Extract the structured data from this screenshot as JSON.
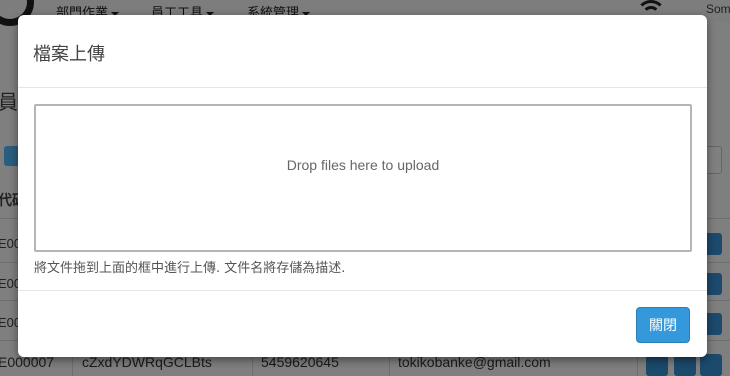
{
  "navbar": {
    "menu": [
      {
        "label": "部門作業"
      },
      {
        "label": "員工工具"
      },
      {
        "label": "系統管理"
      }
    ],
    "user_label": "Som"
  },
  "background": {
    "page_title": "員工",
    "column_header": "代碼",
    "row_labels": [
      "E00",
      "E00",
      "E00"
    ],
    "last_row": {
      "code": "E000007",
      "name": "cZxdYDWRqGCLBts",
      "phone": "5459620645",
      "email": "tokikobanke@gmail.com"
    }
  },
  "modal": {
    "title": "檔案上傳",
    "dropzone_message": "Drop files here to upload",
    "help_text": "將文件拖到上面的框中進行上傳. 文件名將存儲為描述.",
    "close_label": "關閉",
    "close_color": "#3498db"
  }
}
